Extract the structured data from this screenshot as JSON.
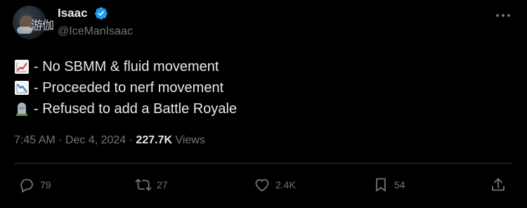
{
  "author": {
    "display_name": "Isaac",
    "handle": "@IceManIsaac",
    "avatar_watermark": "游伽",
    "verified_icon": "verified-badge-icon",
    "verified_color": "#1d9bf0"
  },
  "tweet": {
    "lines": [
      {
        "icon": "chart-increasing-icon",
        "text": "- No SBMM & fluid movement"
      },
      {
        "icon": "chart-decreasing-icon",
        "text": "- Proceeded to nerf movement"
      },
      {
        "icon": "headstone-icon",
        "text": "- Refused to add a Battle Royale"
      }
    ]
  },
  "meta": {
    "time": "7:45 AM",
    "sep1": " · ",
    "date": "Dec 4, 2024",
    "sep2": " · ",
    "views_count": "227.7K",
    "views_label": " Views"
  },
  "actions": {
    "reply": {
      "icon": "reply-icon",
      "count": "79"
    },
    "retweet": {
      "icon": "retweet-icon",
      "count": "27"
    },
    "like": {
      "icon": "heart-icon",
      "count": "2.4K"
    },
    "bookmark": {
      "icon": "bookmark-icon",
      "count": "54"
    },
    "share": {
      "icon": "share-icon"
    }
  },
  "colors": {
    "background": "#000000",
    "text_primary": "#e7e9ea",
    "text_secondary": "#71767b",
    "divider": "#2f3336"
  }
}
